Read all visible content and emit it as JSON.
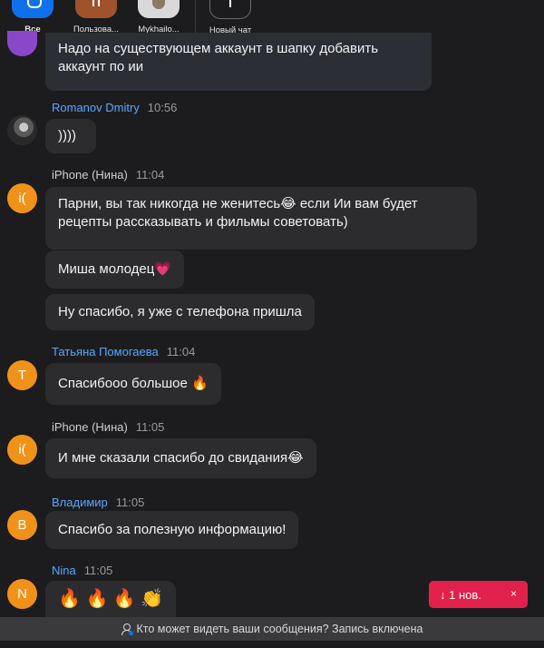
{
  "topbar": {
    "items": [
      {
        "label": "Все",
        "icon": "chat-bubble-icon",
        "color": "#0e71eb"
      },
      {
        "label": "Пользова...",
        "icon": "user-initials-icon",
        "color": "#a0522d"
      },
      {
        "label": "Mykhailo...",
        "icon": "user-photo-icon",
        "color": "#d9d9d9"
      },
      {
        "label": "Новый чат",
        "icon": "plus-icon",
        "color": "#1c1c1e"
      }
    ]
  },
  "messages": {
    "first_bubble": "Надо на существующем аккаунт в шапку добавить аккаунт по ии",
    "groups": [
      {
        "sender": "Romanov Dmitry",
        "time": "10:56",
        "avatar_letter": "",
        "bubbles": [
          "))))"
        ]
      },
      {
        "sender": "iPhone (Нина)",
        "time": "11:04",
        "avatar_letter": "i(",
        "bubbles": [
          "Парни, вы так никогда не женитесь😂 если Ии вам будет рецепты рассказывать и фильмы советовать)",
          "Миша молодец💗",
          "Ну спасибо, я уже с телефона пришла"
        ]
      },
      {
        "sender": "Татьяна Помогаева",
        "time": "11:04",
        "avatar_letter": "T",
        "bubbles": [
          "Спасибооо большое 🔥"
        ]
      },
      {
        "sender": "iPhone (Нина)",
        "time": "11:05",
        "avatar_letter": "i(",
        "bubbles": [
          "И мне сказали спасибо до свидания😂"
        ]
      },
      {
        "sender": "Владимир",
        "time": "11:05",
        "avatar_letter": "B",
        "bubbles": [
          "Спасибо за полезную информацию!"
        ]
      },
      {
        "sender": "Nina",
        "time": "11:05",
        "avatar_letter": "N",
        "bubbles": [
          "🔥 🔥 🔥 👏"
        ]
      }
    ]
  },
  "new_badge": {
    "label": "↓ 1 нов.",
    "close": "×"
  },
  "footer": {
    "text": "Кто может видеть ваши сообщения? Запись включена"
  },
  "colors": {
    "accent": "#0e71eb",
    "avatar_orange": "#f0921a",
    "badge_red": "#e2214a",
    "name_blue": "#5aa7ff"
  }
}
